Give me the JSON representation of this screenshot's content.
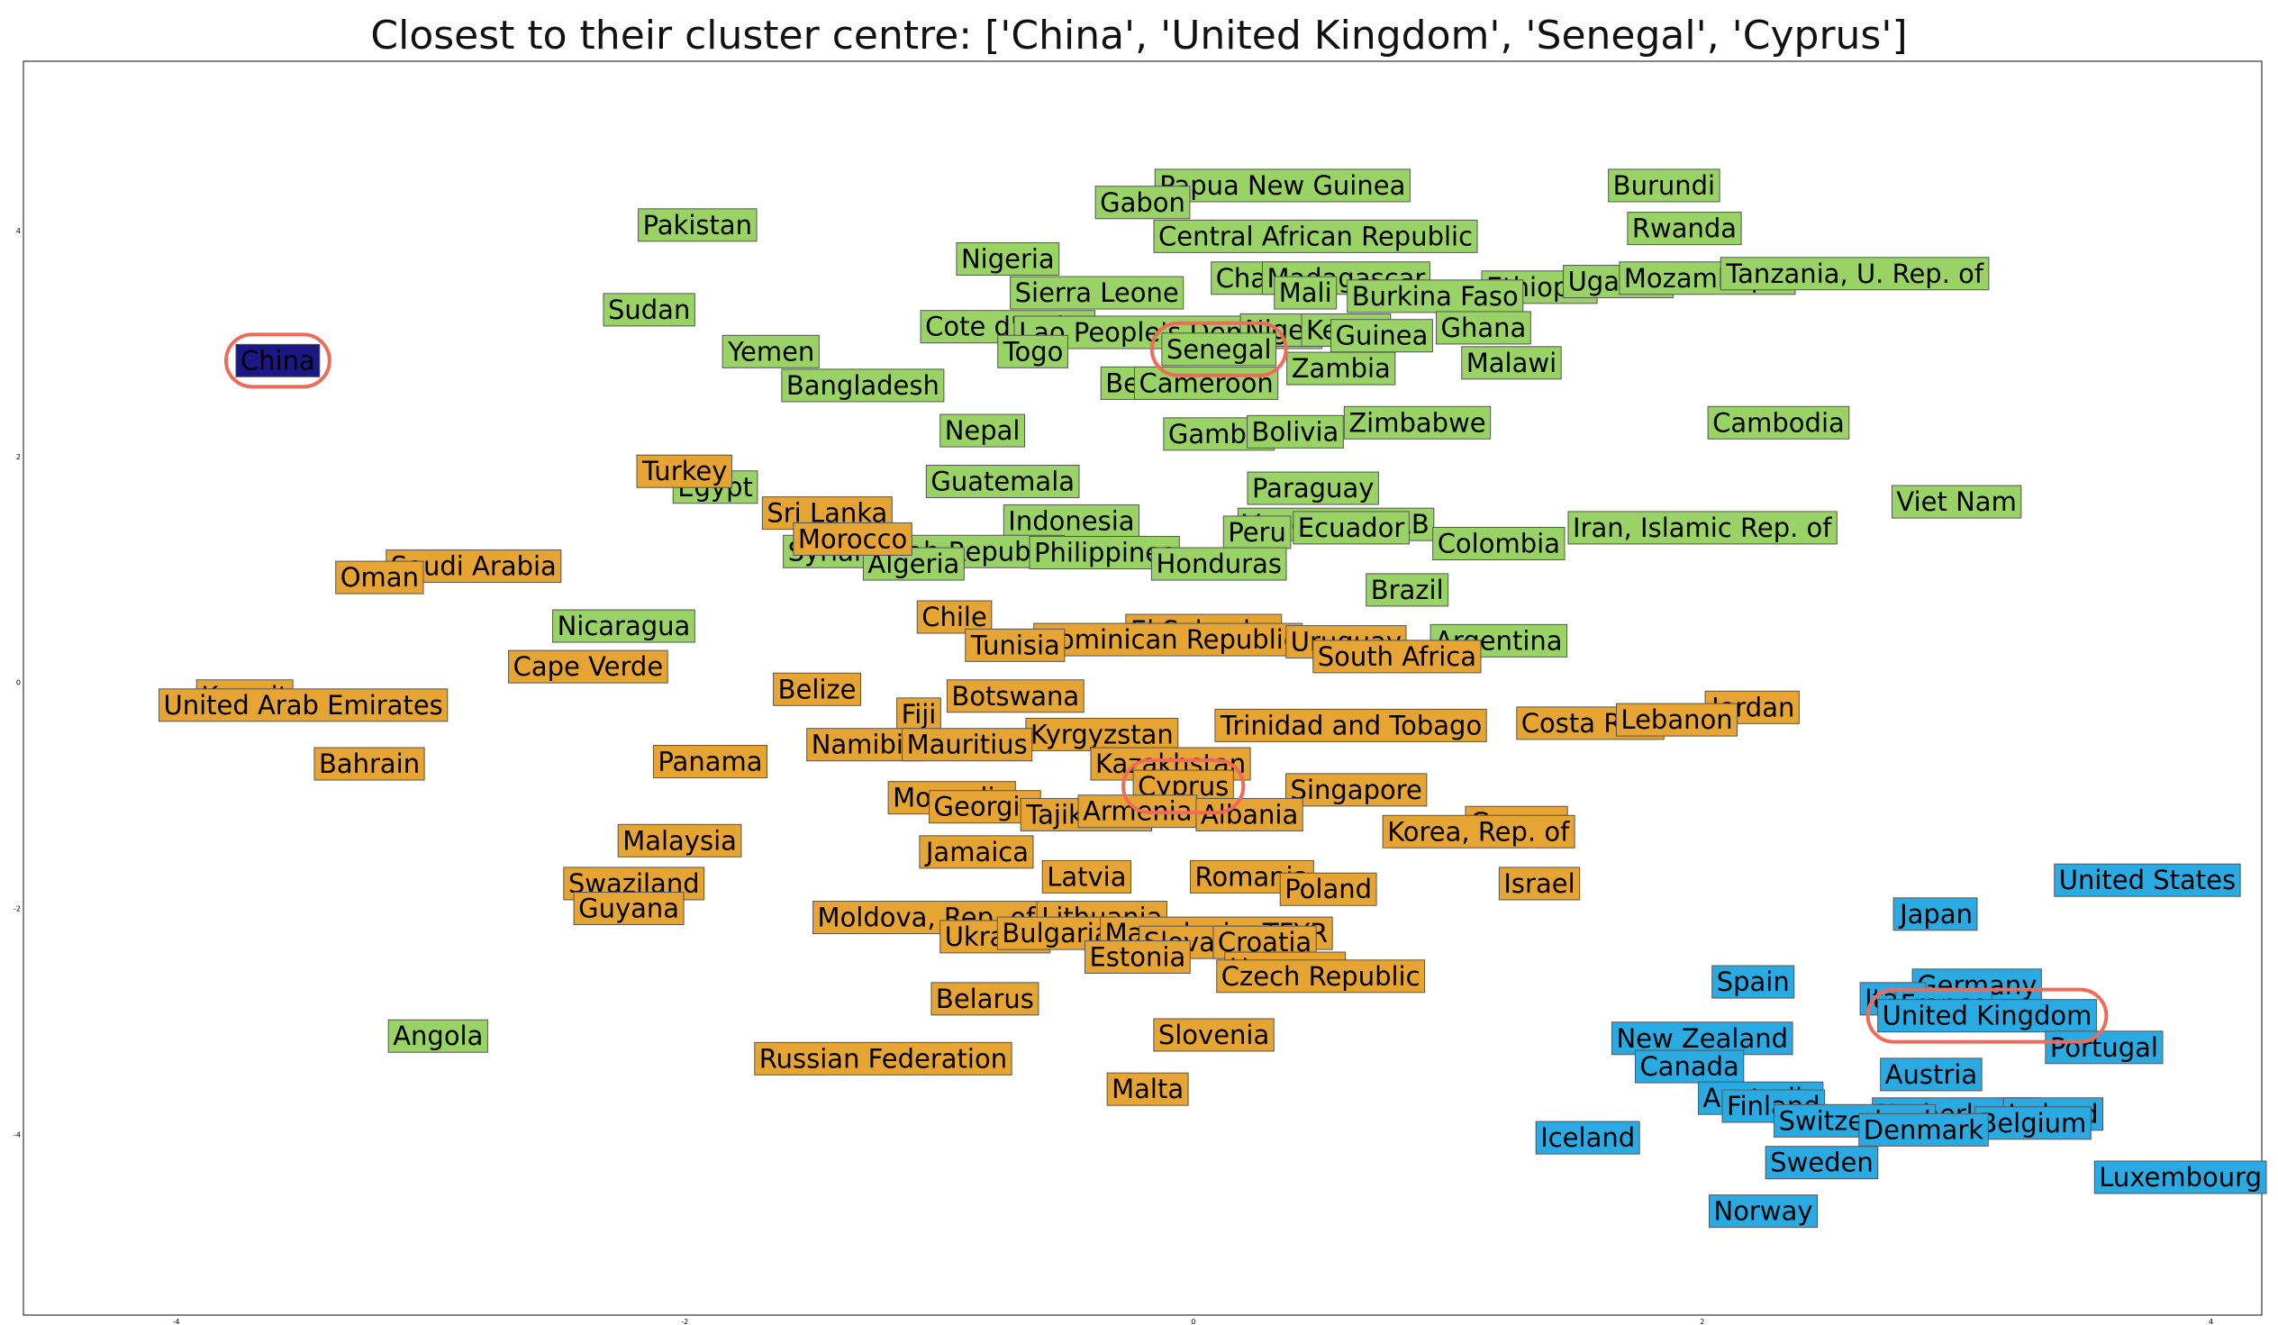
{
  "chart_data": {
    "type": "scatter",
    "title": "Closest to their cluster centre: ['China', 'United Kingdom', 'Senegal', 'Cyprus']",
    "xlim": [
      -4.6,
      4.2
    ],
    "ylim": [
      -5.6,
      5.5
    ],
    "x_ticks": [
      -4,
      -2,
      0,
      2,
      4
    ],
    "y_ticks": [
      4,
      2,
      0,
      -2,
      -4
    ],
    "x_tick_labels": [
      "-4",
      "-2",
      "0",
      "2",
      "4"
    ],
    "y_tick_labels": [
      "4",
      "2",
      "0",
      "-2",
      "-4"
    ],
    "grid": false,
    "legend": "none",
    "colors": {
      "green": "#99d366",
      "orange": "#e6a433",
      "blue": "#29aae2",
      "navy": "#1c1786",
      "highlight": "#f06a5a"
    },
    "highlighted": [
      "China",
      "United Kingdom",
      "Senegal",
      "Cyprus"
    ],
    "points": [
      {
        "label": "China",
        "x": -3.6,
        "y": 2.85,
        "cluster": "navy"
      },
      {
        "label": "Papua New Guinea",
        "x": 0.35,
        "y": 4.4,
        "cluster": "green"
      },
      {
        "label": "Gabon",
        "x": -0.2,
        "y": 4.25,
        "cluster": "green"
      },
      {
        "label": "Burundi",
        "x": 1.85,
        "y": 4.4,
        "cluster": "green"
      },
      {
        "label": "Pakistan",
        "x": -1.95,
        "y": 4.05,
        "cluster": "green"
      },
      {
        "label": "Rwanda",
        "x": 1.93,
        "y": 4.02,
        "cluster": "green"
      },
      {
        "label": "Central African Republic",
        "x": 0.48,
        "y": 3.95,
        "cluster": "green"
      },
      {
        "label": "Nigeria",
        "x": -0.73,
        "y": 3.75,
        "cluster": "green"
      },
      {
        "label": "Chad",
        "x": 0.22,
        "y": 3.58,
        "cluster": "green"
      },
      {
        "label": "Madagascar",
        "x": 0.6,
        "y": 3.58,
        "cluster": "green"
      },
      {
        "label": "Mali",
        "x": 0.44,
        "y": 3.45,
        "cluster": "green"
      },
      {
        "label": "Ethiopia",
        "x": 1.36,
        "y": 3.5,
        "cluster": "green"
      },
      {
        "label": "Uganda",
        "x": 1.67,
        "y": 3.55,
        "cluster": "green"
      },
      {
        "label": "Mozambique",
        "x": 2.02,
        "y": 3.58,
        "cluster": "green"
      },
      {
        "label": "Tanzania, U. Rep. of",
        "x": 2.6,
        "y": 3.62,
        "cluster": "green"
      },
      {
        "label": "Sierra Leone",
        "x": -0.38,
        "y": 3.45,
        "cluster": "green"
      },
      {
        "label": "Burkina Faso",
        "x": 0.95,
        "y": 3.42,
        "cluster": "green"
      },
      {
        "label": "Sudan",
        "x": -2.14,
        "y": 3.3,
        "cluster": "green"
      },
      {
        "label": "Cote d'Ivoire",
        "x": -0.73,
        "y": 3.15,
        "cluster": "green"
      },
      {
        "label": "Lao People's Dem. Rep",
        "x": -0.1,
        "y": 3.1,
        "cluster": "green"
      },
      {
        "label": "Niger",
        "x": 0.34,
        "y": 3.12,
        "cluster": "green"
      },
      {
        "label": "Kenya",
        "x": 0.6,
        "y": 3.12,
        "cluster": "green"
      },
      {
        "label": "Guinea",
        "x": 0.74,
        "y": 3.07,
        "cluster": "green"
      },
      {
        "label": "Ghana",
        "x": 1.14,
        "y": 3.14,
        "cluster": "green"
      },
      {
        "label": "Yemen",
        "x": -1.66,
        "y": 2.93,
        "cluster": "green"
      },
      {
        "label": "Togo",
        "x": -0.63,
        "y": 2.93,
        "cluster": "green"
      },
      {
        "label": "Senegal",
        "x": 0.1,
        "y": 2.95,
        "cluster": "green"
      },
      {
        "label": "Malawi",
        "x": 1.25,
        "y": 2.83,
        "cluster": "green"
      },
      {
        "label": "Zambia",
        "x": 0.58,
        "y": 2.78,
        "cluster": "green"
      },
      {
        "label": "Bangladesh",
        "x": -1.3,
        "y": 2.63,
        "cluster": "green"
      },
      {
        "label": "Benin",
        "x": -0.2,
        "y": 2.65,
        "cluster": "green"
      },
      {
        "label": "Cameroon",
        "x": 0.05,
        "y": 2.65,
        "cluster": "green"
      },
      {
        "label": "Cambodia",
        "x": 2.3,
        "y": 2.3,
        "cluster": "green"
      },
      {
        "label": "Zimbabwe",
        "x": 0.88,
        "y": 2.3,
        "cluster": "green"
      },
      {
        "label": "Nepal",
        "x": -0.83,
        "y": 2.23,
        "cluster": "green"
      },
      {
        "label": "Gambia",
        "x": 0.1,
        "y": 2.2,
        "cluster": "green"
      },
      {
        "label": "Bolivia",
        "x": 0.4,
        "y": 2.22,
        "cluster": "green"
      },
      {
        "label": "Egypt",
        "x": -1.88,
        "y": 1.73,
        "cluster": "green"
      },
      {
        "label": "Guatemala",
        "x": -0.75,
        "y": 1.78,
        "cluster": "green"
      },
      {
        "label": "Paraguay",
        "x": 0.47,
        "y": 1.72,
        "cluster": "green"
      },
      {
        "label": "Viet Nam",
        "x": 3.0,
        "y": 1.6,
        "cluster": "green"
      },
      {
        "label": "Indonesia",
        "x": -0.48,
        "y": 1.43,
        "cluster": "green"
      },
      {
        "label": "Venezuela, RB",
        "x": 0.56,
        "y": 1.4,
        "cluster": "green"
      },
      {
        "label": "Peru",
        "x": 0.25,
        "y": 1.33,
        "cluster": "green"
      },
      {
        "label": "Ecuador",
        "x": 0.62,
        "y": 1.37,
        "cluster": "green"
      },
      {
        "label": "Iran, Islamic Rep. of",
        "x": 2.0,
        "y": 1.37,
        "cluster": "green"
      },
      {
        "label": "Colombia",
        "x": 1.2,
        "y": 1.23,
        "cluster": "green"
      },
      {
        "label": "Syrian Arab Republic",
        "x": -1.06,
        "y": 1.16,
        "cluster": "green"
      },
      {
        "label": "Philippines",
        "x": -0.35,
        "y": 1.15,
        "cluster": "green"
      },
      {
        "label": "Algeria",
        "x": -1.1,
        "y": 1.05,
        "cluster": "green"
      },
      {
        "label": "Honduras",
        "x": 0.1,
        "y": 1.05,
        "cluster": "green"
      },
      {
        "label": "Brazil",
        "x": 0.84,
        "y": 0.82,
        "cluster": "green"
      },
      {
        "label": "Nicaragua",
        "x": -2.24,
        "y": 0.5,
        "cluster": "green"
      },
      {
        "label": "Argentina",
        "x": 1.2,
        "y": 0.37,
        "cluster": "green"
      },
      {
        "label": "Angola",
        "x": -2.97,
        "y": -3.13,
        "cluster": "green"
      },
      {
        "label": "Turkey",
        "x": -2.0,
        "y": 1.87,
        "cluster": "orange"
      },
      {
        "label": "Sri Lanka",
        "x": -1.44,
        "y": 1.5,
        "cluster": "orange"
      },
      {
        "label": "Morocco",
        "x": -1.34,
        "y": 1.27,
        "cluster": "orange"
      },
      {
        "label": "Saudi Arabia",
        "x": -2.83,
        "y": 1.03,
        "cluster": "orange"
      },
      {
        "label": "Oman",
        "x": -3.2,
        "y": 0.93,
        "cluster": "orange"
      },
      {
        "label": "Chile",
        "x": -0.94,
        "y": 0.58,
        "cluster": "orange"
      },
      {
        "label": "El Salvador",
        "x": 0.04,
        "y": 0.46,
        "cluster": "orange"
      },
      {
        "label": "Dominican Republic",
        "x": -0.1,
        "y": 0.38,
        "cluster": "orange"
      },
      {
        "label": "Uruguay",
        "x": 0.6,
        "y": 0.36,
        "cluster": "orange"
      },
      {
        "label": "Tunisia",
        "x": -0.7,
        "y": 0.33,
        "cluster": "orange"
      },
      {
        "label": "South Africa",
        "x": 0.8,
        "y": 0.23,
        "cluster": "orange"
      },
      {
        "label": "Cape Verde",
        "x": -2.38,
        "y": 0.14,
        "cluster": "orange"
      },
      {
        "label": "Belize",
        "x": -1.48,
        "y": -0.06,
        "cluster": "orange"
      },
      {
        "label": "Botswana",
        "x": -0.7,
        "y": -0.12,
        "cluster": "orange"
      },
      {
        "label": "Kuwait",
        "x": -3.73,
        "y": -0.12,
        "cluster": "orange"
      },
      {
        "label": "United Arab Emirates",
        "x": -3.5,
        "y": -0.2,
        "cluster": "orange"
      },
      {
        "label": "Jordan",
        "x": 2.2,
        "y": -0.22,
        "cluster": "orange"
      },
      {
        "label": "Fiji",
        "x": -1.08,
        "y": -0.28,
        "cluster": "orange"
      },
      {
        "label": "Trinidad and Tobago",
        "x": 0.62,
        "y": -0.38,
        "cluster": "orange"
      },
      {
        "label": "Costa Rica",
        "x": 1.56,
        "y": -0.36,
        "cluster": "orange"
      },
      {
        "label": "Lebanon",
        "x": 1.9,
        "y": -0.33,
        "cluster": "orange"
      },
      {
        "label": "Kyrgyzstan",
        "x": -0.36,
        "y": -0.46,
        "cluster": "orange"
      },
      {
        "label": "Namibia",
        "x": -1.29,
        "y": -0.55,
        "cluster": "orange"
      },
      {
        "label": "Mauritius",
        "x": -0.89,
        "y": -0.55,
        "cluster": "orange"
      },
      {
        "label": "Bahrain",
        "x": -3.24,
        "y": -0.72,
        "cluster": "orange"
      },
      {
        "label": "Panama",
        "x": -1.9,
        "y": -0.7,
        "cluster": "orange"
      },
      {
        "label": "Kazakhstan",
        "x": -0.09,
        "y": -0.72,
        "cluster": "orange"
      },
      {
        "label": "Cyprus",
        "x": -0.04,
        "y": -0.92,
        "cluster": "orange"
      },
      {
        "label": "Singapore",
        "x": 0.64,
        "y": -0.95,
        "cluster": "orange"
      },
      {
        "label": "Mongolia",
        "x": -0.95,
        "y": -1.02,
        "cluster": "orange"
      },
      {
        "label": "Georgia",
        "x": -0.82,
        "y": -1.1,
        "cluster": "orange"
      },
      {
        "label": "Tajikistan",
        "x": -0.42,
        "y": -1.17,
        "cluster": "orange"
      },
      {
        "label": "Armenia",
        "x": -0.22,
        "y": -1.14,
        "cluster": "orange"
      },
      {
        "label": "Albania",
        "x": 0.22,
        "y": -1.17,
        "cluster": "orange"
      },
      {
        "label": "Greece",
        "x": 1.27,
        "y": -1.24,
        "cluster": "orange"
      },
      {
        "label": "Korea, Rep. of",
        "x": 1.12,
        "y": -1.32,
        "cluster": "orange"
      },
      {
        "label": "Malaysia",
        "x": -2.02,
        "y": -1.4,
        "cluster": "orange"
      },
      {
        "label": "Jamaica",
        "x": -0.85,
        "y": -1.5,
        "cluster": "orange"
      },
      {
        "label": "Latvia",
        "x": -0.42,
        "y": -1.72,
        "cluster": "orange"
      },
      {
        "label": "Romania",
        "x": 0.23,
        "y": -1.72,
        "cluster": "orange"
      },
      {
        "label": "Poland",
        "x": 0.53,
        "y": -1.83,
        "cluster": "orange"
      },
      {
        "label": "Swaziland",
        "x": -2.2,
        "y": -1.78,
        "cluster": "orange"
      },
      {
        "label": "Israel",
        "x": 1.36,
        "y": -1.78,
        "cluster": "orange"
      },
      {
        "label": "Guyana",
        "x": -2.22,
        "y": -2.0,
        "cluster": "orange"
      },
      {
        "label": "Moldova, Rep. of",
        "x": -1.05,
        "y": -2.08,
        "cluster": "orange"
      },
      {
        "label": "Lithuania",
        "x": -0.36,
        "y": -2.08,
        "cluster": "orange"
      },
      {
        "label": "Ukraine",
        "x": -0.78,
        "y": -2.25,
        "cluster": "orange"
      },
      {
        "label": "Bulgaria",
        "x": -0.54,
        "y": -2.22,
        "cluster": "orange"
      },
      {
        "label": "Macedonia, TFYR",
        "x": 0.09,
        "y": -2.22,
        "cluster": "orange"
      },
      {
        "label": "Slovakia",
        "x": 0.02,
        "y": -2.3,
        "cluster": "orange"
      },
      {
        "label": "Croatia",
        "x": 0.28,
        "y": -2.3,
        "cluster": "orange"
      },
      {
        "label": "Estonia",
        "x": -0.22,
        "y": -2.43,
        "cluster": "orange"
      },
      {
        "label": "Hungary",
        "x": 0.36,
        "y": -2.53,
        "cluster": "orange"
      },
      {
        "label": "Czech Republic",
        "x": 0.5,
        "y": -2.6,
        "cluster": "orange"
      },
      {
        "label": "Belarus",
        "x": -0.82,
        "y": -2.8,
        "cluster": "orange"
      },
      {
        "label": "Slovenia",
        "x": 0.08,
        "y": -3.12,
        "cluster": "orange"
      },
      {
        "label": "Russian Federation",
        "x": -1.22,
        "y": -3.33,
        "cluster": "orange"
      },
      {
        "label": "Malta",
        "x": -0.18,
        "y": -3.6,
        "cluster": "orange"
      },
      {
        "label": "United States",
        "x": 3.75,
        "y": -1.75,
        "cluster": "blue"
      },
      {
        "label": "Japan",
        "x": 2.92,
        "y": -2.05,
        "cluster": "blue"
      },
      {
        "label": "Spain",
        "x": 2.2,
        "y": -2.65,
        "cluster": "blue"
      },
      {
        "label": "Germany",
        "x": 3.08,
        "y": -2.68,
        "cluster": "blue"
      },
      {
        "label": "Italy",
        "x": 2.75,
        "y": -2.8,
        "cluster": "blue"
      },
      {
        "label": "France",
        "x": 2.95,
        "y": -2.85,
        "cluster": "blue"
      },
      {
        "label": "United Kingdom",
        "x": 3.12,
        "y": -2.95,
        "cluster": "blue"
      },
      {
        "label": "New Zealand",
        "x": 2.0,
        "y": -3.15,
        "cluster": "blue"
      },
      {
        "label": "Portugal",
        "x": 3.58,
        "y": -3.23,
        "cluster": "blue"
      },
      {
        "label": "Canada",
        "x": 1.95,
        "y": -3.4,
        "cluster": "blue"
      },
      {
        "label": "Austria",
        "x": 2.9,
        "y": -3.47,
        "cluster": "blue"
      },
      {
        "label": "Australia",
        "x": 2.23,
        "y": -3.68,
        "cluster": "blue"
      },
      {
        "label": "Finland",
        "x": 2.28,
        "y": -3.75,
        "cluster": "blue"
      },
      {
        "label": "Netherlands",
        "x": 3.0,
        "y": -3.82,
        "cluster": "blue"
      },
      {
        "label": "Ireland",
        "x": 3.38,
        "y": -3.82,
        "cluster": "blue"
      },
      {
        "label": "Switzerland",
        "x": 2.6,
        "y": -3.88,
        "cluster": "blue"
      },
      {
        "label": "Belgium",
        "x": 3.3,
        "y": -3.9,
        "cluster": "blue"
      },
      {
        "label": "Denmark",
        "x": 2.87,
        "y": -3.96,
        "cluster": "blue"
      },
      {
        "label": "Iceland",
        "x": 1.55,
        "y": -4.03,
        "cluster": "blue"
      },
      {
        "label": "Sweden",
        "x": 2.47,
        "y": -4.25,
        "cluster": "blue"
      },
      {
        "label": "Luxembourg",
        "x": 3.88,
        "y": -4.38,
        "cluster": "blue"
      },
      {
        "label": "Norway",
        "x": 2.24,
        "y": -4.68,
        "cluster": "blue"
      }
    ]
  }
}
